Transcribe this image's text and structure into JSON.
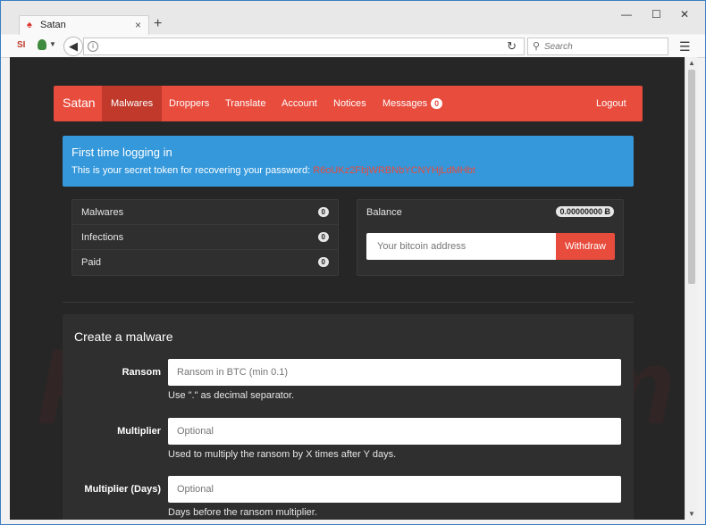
{
  "browser": {
    "tab_title": "Satan",
    "new_tab": "+",
    "tab_close": "×",
    "window_minimize": "—",
    "window_maximize": "☐",
    "window_close": "✕",
    "ext1": "SI",
    "search_placeholder": "Search"
  },
  "nav": {
    "brand": "Satan",
    "items": [
      {
        "label": "Malwares",
        "active": true
      },
      {
        "label": "Droppers",
        "active": false
      },
      {
        "label": "Translate",
        "active": false
      },
      {
        "label": "Account",
        "active": false
      },
      {
        "label": "Notices",
        "active": false
      },
      {
        "label": "Messages",
        "active": false
      }
    ],
    "messages_count": "0",
    "logout": "Logout"
  },
  "alert": {
    "title": "First time logging in",
    "text": "This is your secret token for recovering your password:",
    "token": "R6oUKz2FbjWRBNbYCNYHjLdMHbt"
  },
  "stats": [
    {
      "label": "Malwares",
      "value": "0"
    },
    {
      "label": "Infections",
      "value": "0"
    },
    {
      "label": "Paid",
      "value": "0"
    }
  ],
  "balance": {
    "label": "Balance",
    "value": "0.00000000 Ƀ",
    "address_placeholder": "Your bitcoin address",
    "withdraw": "Withdraw"
  },
  "form": {
    "title": "Create a malware",
    "fields": [
      {
        "label": "Ransom",
        "placeholder": "Ransom in BTC (min 0.1)",
        "help": "Use \".\" as decimal separator."
      },
      {
        "label": "Multiplier",
        "placeholder": "Optional",
        "help": "Used to multiply the ransom by X times after Y days."
      },
      {
        "label": "Multiplier (Days)",
        "placeholder": "Optional",
        "help": "Days before the ransom multiplier."
      }
    ]
  },
  "watermark": "PCrisk.com",
  "colors": {
    "accent": "#e84c3d",
    "alert": "#3498db",
    "page_bg": "#262626",
    "panel_bg": "#2f2f2f"
  }
}
